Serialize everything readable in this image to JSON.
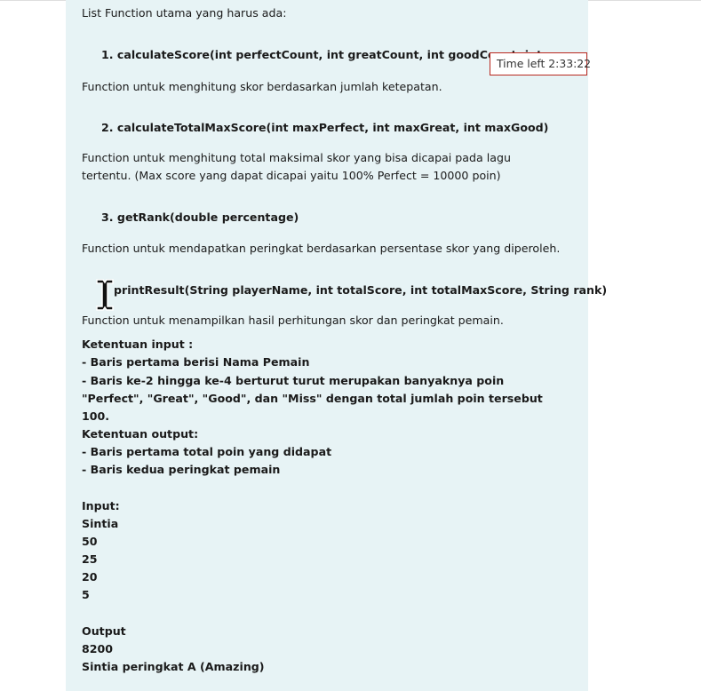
{
  "intro": "List Function utama yang harus ada:",
  "functions": [
    {
      "signature": "1. calculateScore(int perfectCount, int greatCount, int goodCount, int m",
      "description": "Function untuk menghitung skor berdasarkan jumlah ketepatan."
    },
    {
      "signature": "2. calculateTotalMaxScore(int maxPerfect, int maxGreat, int maxGood)",
      "description": "Function untuk menghitung total maksimal skor yang bisa dicapai pada lagu tertentu. (Max score yang dapat dicapai yaitu 100% Perfect = 10000 poin)"
    },
    {
      "signature": "3. getRank(double percentage)",
      "description": "Function untuk mendapatkan peringkat berdasarkan persentase skor yang diperoleh."
    },
    {
      "signature": "printResult(String playerName, int totalScore, int totalMaxScore, String rank)",
      "description": "Function untuk menampilkan hasil perhitungan skor dan peringkat pemain."
    }
  ],
  "input_rules": {
    "heading": "Ketentuan input :",
    "lines": [
      "- Baris pertama berisi Nama Pemain",
      "- Baris ke-2 hingga ke-4 berturut turut merupakan banyaknya poin \"Perfect\", \"Great\", \"Good\", dan \"Miss\" dengan total jumlah poin tersebut 100."
    ]
  },
  "output_rules": {
    "heading": "Ketentuan output:",
    "lines": [
      "- Baris pertama total poin yang didapat",
      "- Baris kedua peringkat pemain"
    ]
  },
  "sample_input": {
    "heading": "Input:",
    "lines": [
      "Sintia",
      "50",
      "25",
      "20",
      "5"
    ]
  },
  "sample_output": {
    "heading": "Output",
    "lines": [
      "8200",
      "Sintia peringkat A (Amazing)"
    ]
  },
  "timer": {
    "text": "Time left 2:33:22"
  },
  "icons": {
    "cursor": "text-cursor-icon"
  }
}
